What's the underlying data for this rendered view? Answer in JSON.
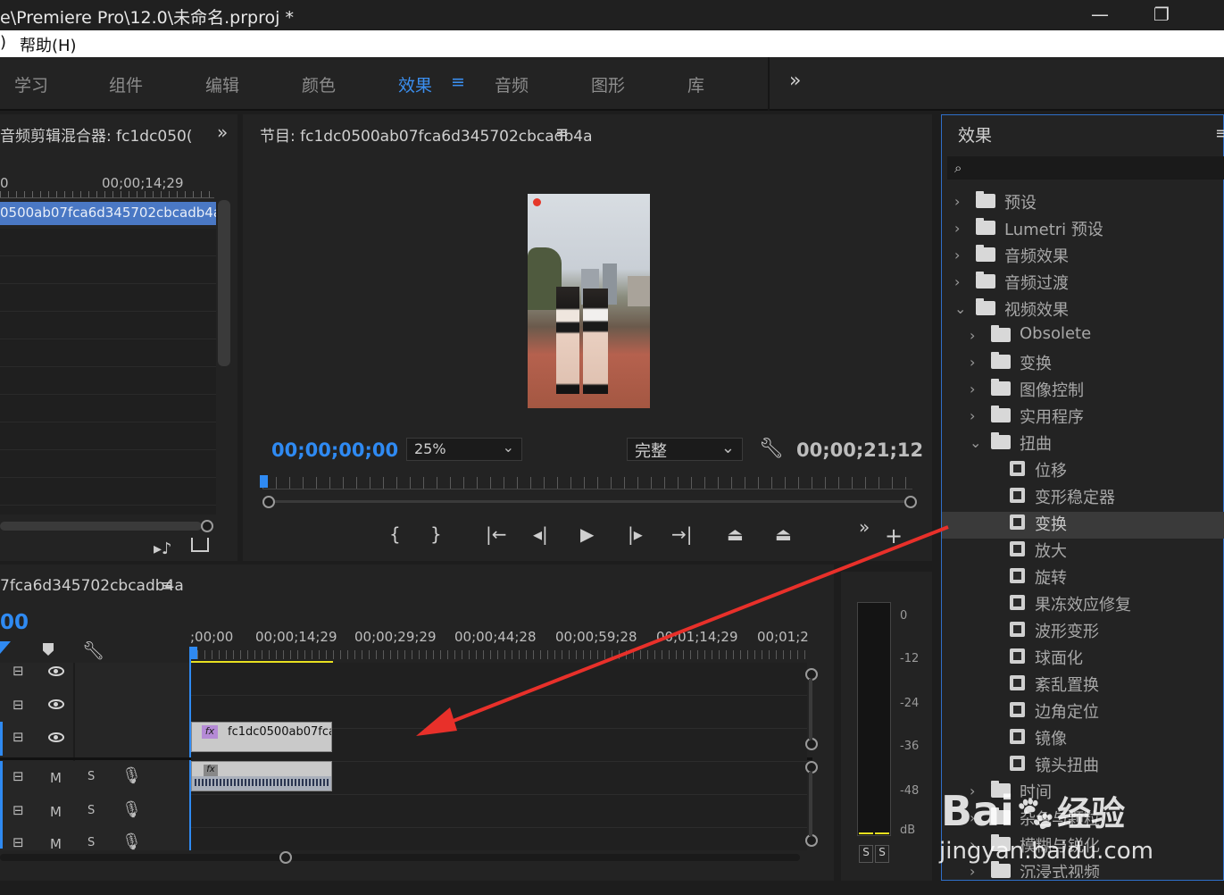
{
  "titlebar": {
    "title": "e\\Premiere Pro\\12.0\\未命名.prproj *",
    "min": "—",
    "max": "❐"
  },
  "menubar": {
    "frag": ")",
    "help": "帮助(H)"
  },
  "workspaces": [
    "学习",
    "组件",
    "编辑",
    "颜色",
    "效果",
    "音频",
    "图形",
    "库"
  ],
  "workspace_active_index": 4,
  "workspace_menu_icon": "≡",
  "workspace_more": "»",
  "mixer": {
    "title": "音频剪辑混合器: fc1dc050(",
    "timecode_left": "0",
    "timecode": "00;00;14;29",
    "clip": "0500ab07fca6d345702cbcadb4a",
    "more": "»"
  },
  "program": {
    "title": "节目: fc1dc0500ab07fca6d345702cbcadb4a",
    "menu": "≡",
    "timecode": "00;00;00;00",
    "zoom": "25%",
    "quality": "完整",
    "duration": "00;00;21;12",
    "more": "»",
    "add": "+"
  },
  "timeline": {
    "title": "7fca6d345702cbcadb4a",
    "menu": "≡",
    "timecode": "00",
    "ruler": [
      ";00;00",
      "00;00;14;29",
      "00;00;29;29",
      "00;00;44;28",
      "00;00;59;28",
      "00;01;14;29",
      "00;01;2"
    ],
    "video_clip": "fc1dc0500ab07fca6",
    "fx": "fx",
    "track_m": "M",
    "track_s": "S"
  },
  "meter": {
    "labels": [
      "0",
      "-12",
      "-24",
      "-36",
      "-48",
      "dB"
    ],
    "solo_left": "S",
    "solo_right": "S"
  },
  "effects": {
    "title": "效果",
    "menu": "≡",
    "items": [
      {
        "label": "预设",
        "level": 0,
        "arrow": "›",
        "kind": "star"
      },
      {
        "label": "Lumetri 预设",
        "level": 0,
        "arrow": "›",
        "kind": "star"
      },
      {
        "label": "音频效果",
        "level": 0,
        "arrow": "›",
        "kind": "folder"
      },
      {
        "label": "音频过渡",
        "level": 0,
        "arrow": "›",
        "kind": "folder"
      },
      {
        "label": "视频效果",
        "level": 0,
        "arrow": "⌄",
        "kind": "folder"
      },
      {
        "label": "Obsolete",
        "level": 1,
        "arrow": "›",
        "kind": "folder"
      },
      {
        "label": "变换",
        "level": 1,
        "arrow": "›",
        "kind": "folder"
      },
      {
        "label": "图像控制",
        "level": 1,
        "arrow": "›",
        "kind": "folder"
      },
      {
        "label": "实用程序",
        "level": 1,
        "arrow": "›",
        "kind": "folder"
      },
      {
        "label": "扭曲",
        "level": 1,
        "arrow": "⌄",
        "kind": "folder"
      },
      {
        "label": "位移",
        "level": 2,
        "arrow": "",
        "kind": "fx"
      },
      {
        "label": "变形稳定器",
        "level": 2,
        "arrow": "",
        "kind": "fx"
      },
      {
        "label": "变换",
        "level": 2,
        "arrow": "",
        "kind": "fx",
        "selected": true
      },
      {
        "label": "放大",
        "level": 2,
        "arrow": "",
        "kind": "fx"
      },
      {
        "label": "旋转",
        "level": 2,
        "arrow": "",
        "kind": "fx"
      },
      {
        "label": "果冻效应修复",
        "level": 2,
        "arrow": "",
        "kind": "fx"
      },
      {
        "label": "波形变形",
        "level": 2,
        "arrow": "",
        "kind": "fx"
      },
      {
        "label": "球面化",
        "level": 2,
        "arrow": "",
        "kind": "fx"
      },
      {
        "label": "紊乱置换",
        "level": 2,
        "arrow": "",
        "kind": "fx"
      },
      {
        "label": "边角定位",
        "level": 2,
        "arrow": "",
        "kind": "fx"
      },
      {
        "label": "镜像",
        "level": 2,
        "arrow": "",
        "kind": "fx"
      },
      {
        "label": "镜头扭曲",
        "level": 2,
        "arrow": "",
        "kind": "fx"
      },
      {
        "label": "时间",
        "level": 1,
        "arrow": "›",
        "kind": "folder"
      },
      {
        "label": "杂色与颗粒",
        "level": 1,
        "arrow": "›",
        "kind": "folder"
      },
      {
        "label": "模糊与锐化",
        "level": 1,
        "arrow": "›",
        "kind": "folder"
      },
      {
        "label": "沉浸式视频",
        "level": 1,
        "arrow": "›",
        "kind": "folder"
      }
    ]
  },
  "watermark": {
    "brand": "Bai",
    "brand2": "经验",
    "url": "jingyan.baidu.com"
  },
  "colors": {
    "accent": "#2f8af2",
    "annotation": "#e8302a",
    "bg": "#232323"
  }
}
